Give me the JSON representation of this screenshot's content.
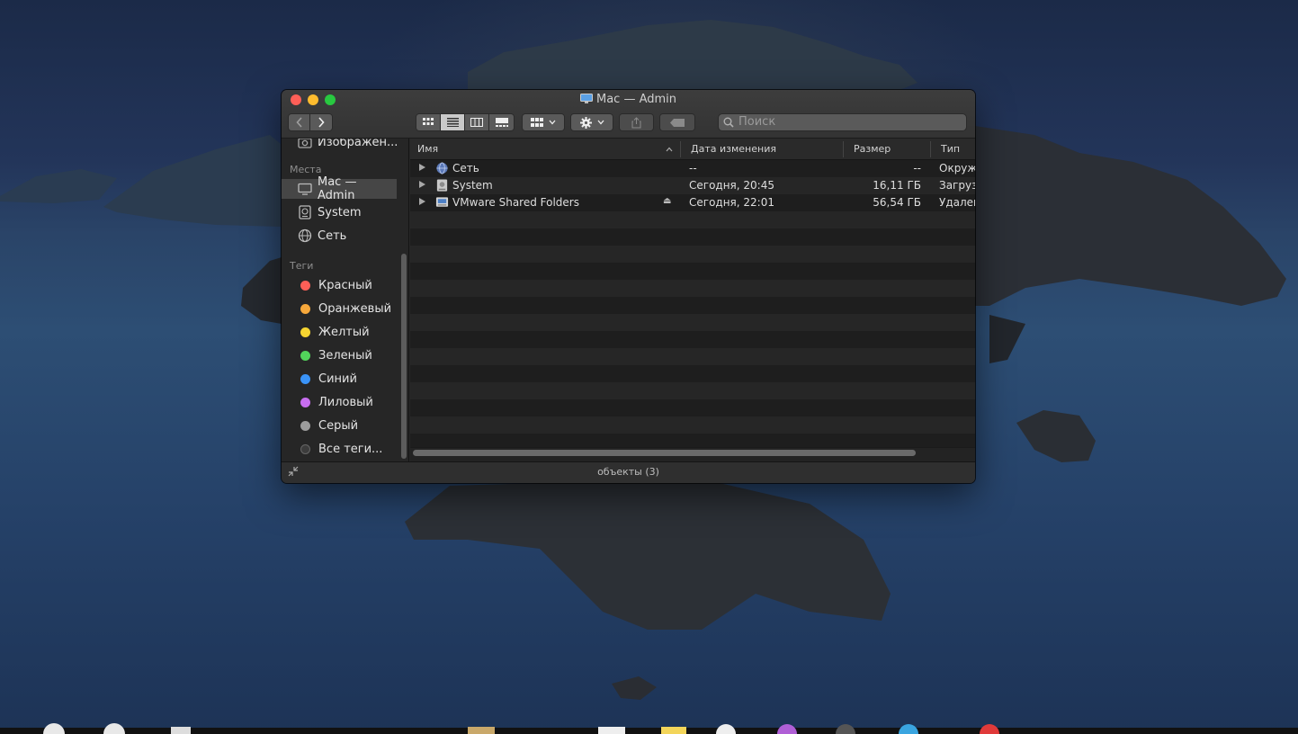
{
  "window": {
    "title": "Mac — Admin",
    "status": "объекты (3)"
  },
  "toolbar": {
    "back_icon": "chevron-left-icon",
    "forward_icon": "chevron-right-icon",
    "views": [
      "icon-view-icon",
      "list-view-icon",
      "column-view-icon",
      "gallery-view-icon"
    ],
    "active_view": "list-view-icon",
    "search_placeholder": "Поиск"
  },
  "sidebar": {
    "partial_item": "Изображен...",
    "places_header": "Места",
    "places": [
      {
        "label": "Mac — Admin",
        "icon": "computer-icon",
        "selected": true
      },
      {
        "label": "System",
        "icon": "disk-icon",
        "selected": false
      },
      {
        "label": "Сеть",
        "icon": "network-icon",
        "selected": false
      }
    ],
    "tags_header": "Теги",
    "tags": [
      {
        "label": "Красный",
        "color": "#fe5f57"
      },
      {
        "label": "Оранжевый",
        "color": "#f7a83b"
      },
      {
        "label": "Желтый",
        "color": "#f6d531"
      },
      {
        "label": "Зеленый",
        "color": "#52d55b"
      },
      {
        "label": "Синий",
        "color": "#3a93f7"
      },
      {
        "label": "Лиловый",
        "color": "#c86ef0"
      },
      {
        "label": "Серый",
        "color": "#9c9c9c"
      },
      {
        "label": "Все теги...",
        "color": "#3c3c3c"
      }
    ]
  },
  "columns": {
    "name": "Имя",
    "date": "Дата изменения",
    "size": "Размер",
    "kind": "Тип"
  },
  "files": [
    {
      "name": "Сеть",
      "icon": "network-icon",
      "date": "--",
      "size": "--",
      "kind": "Окруж",
      "eject": ""
    },
    {
      "name": "System",
      "icon": "disk-icon",
      "date": "Сегодня, 20:45",
      "size": "16,11 ГБ",
      "kind": "Загруз",
      "eject": ""
    },
    {
      "name": "VMware Shared Folders",
      "icon": "network-disk-icon",
      "date": "Сегодня, 22:01",
      "size": "56,54 ГБ",
      "kind": "Удален",
      "eject": "⏏"
    }
  ]
}
